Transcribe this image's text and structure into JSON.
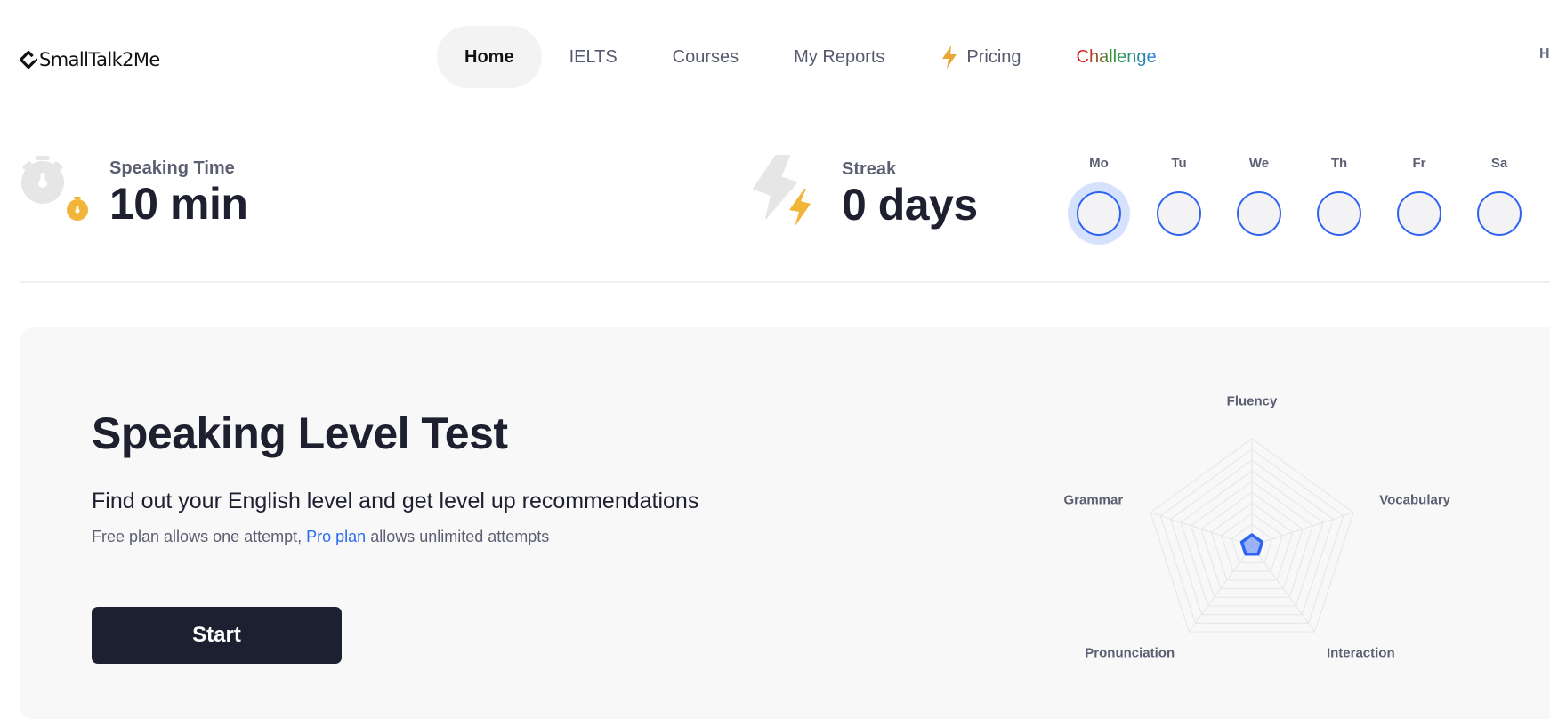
{
  "brand": {
    "name": "SmallTalk2Me"
  },
  "nav": {
    "items": [
      {
        "label": "Home",
        "active": true
      },
      {
        "label": "IELTS"
      },
      {
        "label": "Courses"
      },
      {
        "label": "My Reports"
      },
      {
        "label": "Pricing",
        "icon": "lightning-icon"
      },
      {
        "label": "Challenge"
      }
    ],
    "overflow_text": "H"
  },
  "stats": {
    "speaking_time": {
      "label": "Speaking Time",
      "value": "10 min",
      "icon": "stopwatch-icon"
    },
    "streak": {
      "label": "Streak",
      "value": "0 days",
      "icon": "lightning-icon"
    }
  },
  "week": {
    "days": [
      {
        "label": "Mo",
        "today": true,
        "completed": false
      },
      {
        "label": "Tu",
        "today": false,
        "completed": false
      },
      {
        "label": "We",
        "today": false,
        "completed": false
      },
      {
        "label": "Th",
        "today": false,
        "completed": false
      },
      {
        "label": "Fr",
        "today": false,
        "completed": false
      },
      {
        "label": "Sa",
        "today": false,
        "completed": false
      }
    ]
  },
  "test_card": {
    "title": "Speaking Level Test",
    "subtitle": "Find out your English level and get level up recommendations",
    "note_before": "Free plan allows one attempt, ",
    "note_link": "Pro plan",
    "note_after": " allows unlimited attempts",
    "start_label": "Start"
  },
  "colors": {
    "accent_blue": "#2e64f2",
    "accent_yellow": "#f2b53a",
    "dark": "#1d2030",
    "muted_text": "#5c5f72"
  },
  "chart_data": {
    "type": "radar",
    "axes": [
      "Fluency",
      "Vocabulary",
      "Interaction",
      "Pronunciation",
      "Grammar"
    ],
    "values": [
      1,
      1,
      1,
      1,
      1
    ],
    "range": [
      0,
      10
    ],
    "grid_levels": 10,
    "series_color": "#2e64f2"
  }
}
